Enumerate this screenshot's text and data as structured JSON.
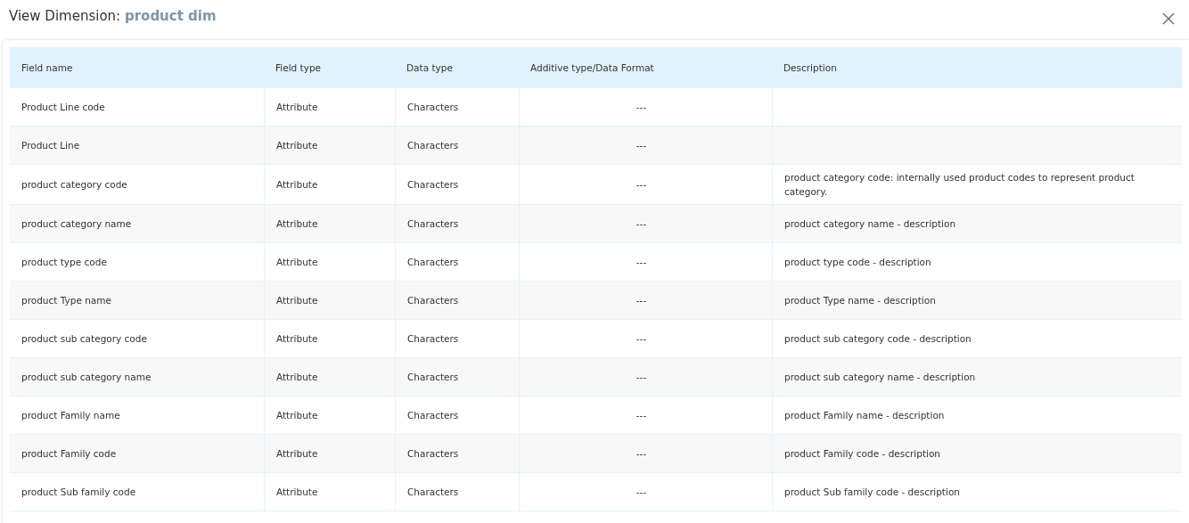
{
  "dialog": {
    "title_prefix": "View Dimension:",
    "title_name": "product dim"
  },
  "table": {
    "columns": [
      "Field name",
      "Field type",
      "Data type",
      "Additive type/Data Format",
      "Description"
    ],
    "rows": [
      [
        "Product Line code",
        "Attribute",
        "Characters",
        "---"
      ],
      [
        "Product Line",
        "Attribute",
        "Characters",
        "---"
      ],
      [
        "product category code",
        "Attribute",
        "Characters",
        "---",
        "product category code: internally used product codes to represent product category."
      ],
      [
        "product category name",
        "Attribute",
        "Characters",
        "---",
        "product category name - description"
      ],
      [
        "product type code",
        "Attribute",
        "Characters",
        "---",
        "product type code - description"
      ],
      [
        "product Type name",
        "Attribute",
        "Characters",
        "---",
        "product Type name - description"
      ],
      [
        "product sub category code",
        "Attribute",
        "Characters",
        "---",
        "product sub category code - description"
      ],
      [
        "product sub category name",
        "Attribute",
        "Characters",
        "---",
        "product sub category name - description"
      ],
      [
        "product Family name",
        "Attribute",
        "Characters",
        "---",
        "product Family name - description"
      ],
      [
        "product Family code",
        "Attribute",
        "Characters",
        "---",
        "product Family code - description"
      ],
      [
        "product Sub family code",
        "Attribute",
        "Characters",
        "---",
        "product Sub family code - description"
      ]
    ]
  }
}
